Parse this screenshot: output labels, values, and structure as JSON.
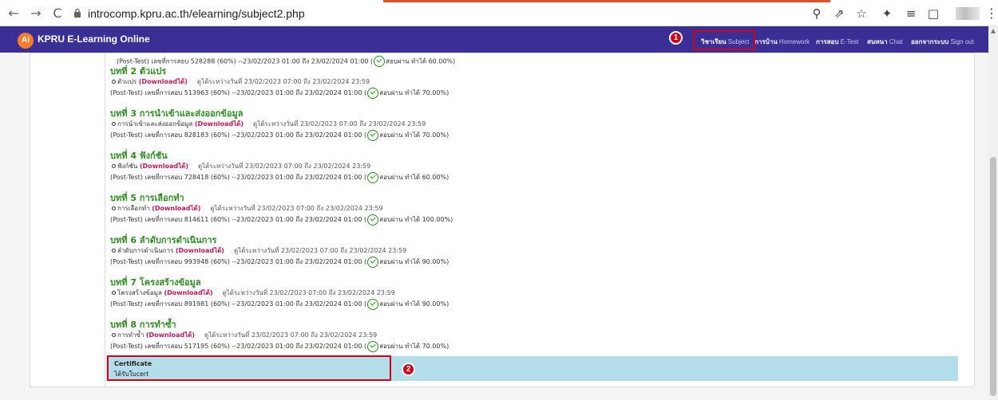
{
  "browser": {
    "back": "←",
    "forward": "→",
    "reload": "C",
    "url": "introcomp.kpru.ac.th/elearning/subject2.php",
    "icons": [
      "zoom-icon",
      "share-icon",
      "star-icon",
      "extensions-icon",
      "media-icon",
      "sidepanel-icon"
    ]
  },
  "navbar": {
    "badge": "Ai",
    "brand": "KPRU E-Learning Online",
    "menu": [
      {
        "th": "วิชาเรียน",
        "en": "Subject"
      },
      {
        "th": "การบ้าน",
        "en": "Homework"
      },
      {
        "th": "การสอบ",
        "en": "E-Test"
      },
      {
        "th": "สนทนา",
        "en": "Chat"
      },
      {
        "th": "ออกจากระบบ",
        "en": "Sign out"
      }
    ]
  },
  "markers": {
    "one": "1",
    "two": "2"
  },
  "top_posttest": "(Post-Test) เลขที่การสอบ 528288 (60%) --23/02/2023 01:00 ถึง 23/02/2024 01:00 (",
  "top_posttest_result": "สอบผ่าน ทำได้ 60.00%)",
  "lessons": [
    {
      "title": "บทที่ 2 ตัวแปร",
      "file": "ตัวแปร",
      "download": "(Downloadได้)",
      "hint": "ดูได้ระหว่างวันที่ 23/02/2023 07:00 ถึง 23/02/2024 23:59",
      "test": "(Post-Test) เลขที่การสอบ 513963 (60%) --23/02/2023 01:00 ถึง 23/02/2024 01:00 (",
      "result": "สอบผ่าน ทำได้ 70.00%)"
    },
    {
      "title": "บทที่ 3 การนำเข้าและส่งออกข้อมูล",
      "file": "การนำเข้าและส่งออกข้อมูล",
      "download": "(Downloadได้)",
      "hint": "ดูได้ระหว่างวันที่ 23/02/2023 07:00 ถึง 23/02/2024 23:59",
      "test": "(Post-Test) เลขที่การสอบ 828183 (60%) --23/02/2023 01:00 ถึง 23/02/2024 01:00 (",
      "result": "สอบผ่าน ทำได้ 70.00%)"
    },
    {
      "title": "บทที่ 4 ฟังก์ชัน",
      "file": "ฟังก์ชัน",
      "download": "(Downloadได้)",
      "hint": "ดูได้ระหว่างวันที่ 23/02/2023 07:00 ถึง 23/02/2024 23:59",
      "test": "(Post-Test) เลขที่การสอบ 728418 (60%) --23/02/2023 01:00 ถึง 23/02/2024 01:00 (",
      "result": "สอบผ่าน ทำได้ 60.00%)"
    },
    {
      "title": "บทที่ 5 การเลือกทำ",
      "file": "การเลือกทำ",
      "download": "(Downloadได้)",
      "hint": "ดูได้ระหว่างวันที่ 23/02/2023 07:00 ถึง 23/02/2024 23:59",
      "test": "(Post-Test) เลขที่การสอบ 814611 (60%) --23/02/2023 01:00 ถึง 23/02/2024 01:00 (",
      "result": "สอบผ่าน ทำได้ 100.00%)"
    },
    {
      "title": "บทที่ 6 ลำดับการดำเนินการ",
      "file": "ลำดับการดำเนินการ",
      "download": "(Downloadได้)",
      "hint": "ดูได้ระหว่างวันที่ 23/02/2023 07:00 ถึง 23/02/2024 23:59",
      "test": "(Post-Test) เลขที่การสอบ 993948 (60%) --23/02/2023 01:00 ถึง 23/02/2024 01:00 (",
      "result": "สอบผ่าน ทำได้ 90.00%)"
    },
    {
      "title": "บทที่ 7 โครงสร้างข้อมูล",
      "file": "โครงสร้างข้อมูล",
      "download": "(Downloadได้)",
      "hint": "ดูได้ระหว่างวันที่ 23/02/2023 07:00 ถึง 23/02/2024 23:59",
      "test": "(Post-Test) เลขที่การสอบ 891981 (60%) --23/02/2023 01:00 ถึง 23/02/2024 01:00 (",
      "result": "สอบผ่าน ทำได้ 90.00%)"
    },
    {
      "title": "บทที่ 8 การทำซ้ำ",
      "file": "การทำซ้ำ",
      "download": "(Downloadได้)",
      "hint": "ดูได้ระหว่างวันที่ 23/02/2023 07:00 ถึง 23/02/2024 23:59",
      "test": "(Post-Test) เลขที่การสอบ 517195 (60%) --23/02/2023 01:00 ถึง 23/02/2024 01:00 (",
      "result": "สอบผ่าน ทำได้ 70.00%)"
    }
  ],
  "certificate": {
    "title": "Certificate",
    "text": "ได้รับใบcert"
  },
  "colors": {
    "navbar": "#3b2f96",
    "lesson_title": "#2e8b22",
    "download": "#c2185b",
    "cert_bar": "#b3dde9",
    "marker": "#d0021b"
  }
}
